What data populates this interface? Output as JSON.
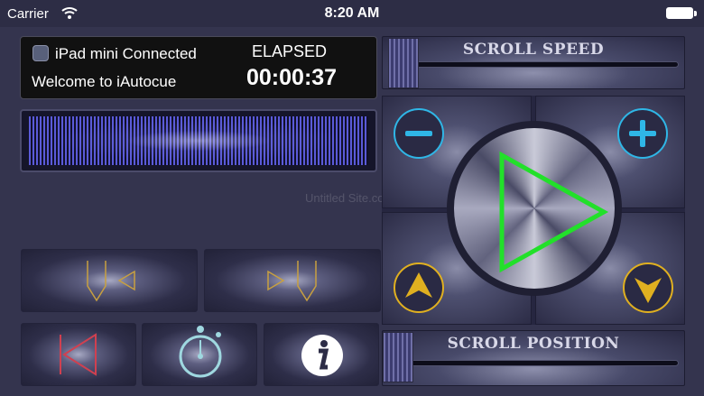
{
  "status_bar": {
    "carrier": "Carrier",
    "time": "8:20 AM"
  },
  "connection": {
    "device_text": "iPad mini Connected",
    "welcome_text": "Welcome to iAutocue"
  },
  "timer": {
    "label": "ELAPSED",
    "value": "00:00:37"
  },
  "watermark": "Untitled Site.com",
  "scroll_speed": {
    "label": "SCROLL SPEED",
    "level": 0.02
  },
  "scroll_position": {
    "label": "SCROLL POSITION",
    "level": 0.0
  },
  "icons": {
    "signal": "wifi-icon",
    "battery": "battery-icon",
    "connection": "ipad-connection-icon",
    "minus": "minus-icon",
    "plus": "plus-icon",
    "play": "play-icon",
    "up": "up-arrow-icon",
    "down": "down-arrow-icon",
    "marker_left": "marker-previous-icon",
    "marker_right": "marker-next-icon",
    "skip_start": "skip-to-start-icon",
    "timer": "stopwatch-icon",
    "info": "info-icon"
  },
  "colors": {
    "accent_green": "#22e02a",
    "accent_cyan": "#2fb6e6",
    "accent_gold": "#e0b020",
    "accent_red": "#d04050",
    "accent_teal": "#9fd8e0"
  }
}
